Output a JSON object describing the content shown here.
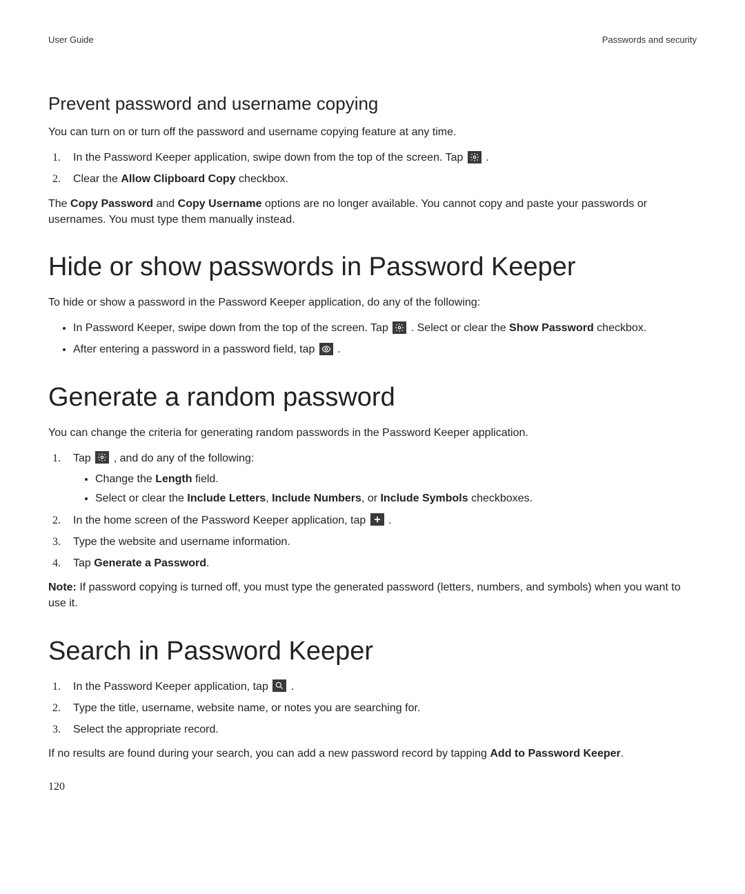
{
  "header": {
    "left": "User Guide",
    "right": "Passwords and security"
  },
  "section1": {
    "heading": "Prevent password and username copying",
    "intro": "You can turn on or turn off the password and username copying feature at any time.",
    "step1_pre": "In the Password Keeper application, swipe down from the top of the screen. Tap ",
    "step1_post": " .",
    "step2_pre": "Clear the ",
    "step2_bold": "Allow Clipboard Copy",
    "step2_post": " checkbox.",
    "after_pre": "The ",
    "after_b1": "Copy Password",
    "after_mid1": " and ",
    "after_b2": "Copy Username",
    "after_post": " options are no longer available. You cannot copy and paste your passwords or usernames. You must type them manually instead."
  },
  "section2": {
    "heading": "Hide or show passwords in Password Keeper",
    "intro": "To hide or show a password in the Password Keeper application, do any of the following:",
    "bullet1_pre": "In Password Keeper, swipe down from the top of the screen. Tap ",
    "bullet1_mid": " . Select or clear the ",
    "bullet1_bold": "Show Password",
    "bullet1_post": " checkbox.",
    "bullet2_pre": "After entering a password in a password field, tap ",
    "bullet2_post": " ."
  },
  "section3": {
    "heading": "Generate a random password",
    "intro": "You can change the criteria for generating random passwords in the Password Keeper application.",
    "step1_pre": "Tap ",
    "step1_post": " , and do any of the following:",
    "sub1_pre": "Change the ",
    "sub1_bold": "Length",
    "sub1_post": " field.",
    "sub2_pre": "Select or clear the ",
    "sub2_b1": "Include Letters",
    "sub2_sep1": ", ",
    "sub2_b2": "Include Numbers",
    "sub2_sep2": ", or ",
    "sub2_b3": "Include Symbols",
    "sub2_post": " checkboxes.",
    "step2_pre": "In the home screen of the Password Keeper application, tap ",
    "step2_post": " .",
    "step3": "Type the website and username information.",
    "step4_pre": "Tap ",
    "step4_bold": "Generate a Password",
    "step4_post": ".",
    "note_bold": "Note:",
    "note_post": " If password copying is turned off, you must type the generated password (letters, numbers, and symbols) when you want to use it."
  },
  "section4": {
    "heading": "Search in Password Keeper",
    "step1_pre": "In the Password Keeper application, tap ",
    "step1_post": " .",
    "step2": "Type the title, username, website name, or notes you are searching for.",
    "step3": "Select the appropriate record.",
    "after_pre": "If no results are found during your search, you can add a new password record by tapping ",
    "after_bold": "Add to Password Keeper",
    "after_post": "."
  },
  "page_number": "120"
}
